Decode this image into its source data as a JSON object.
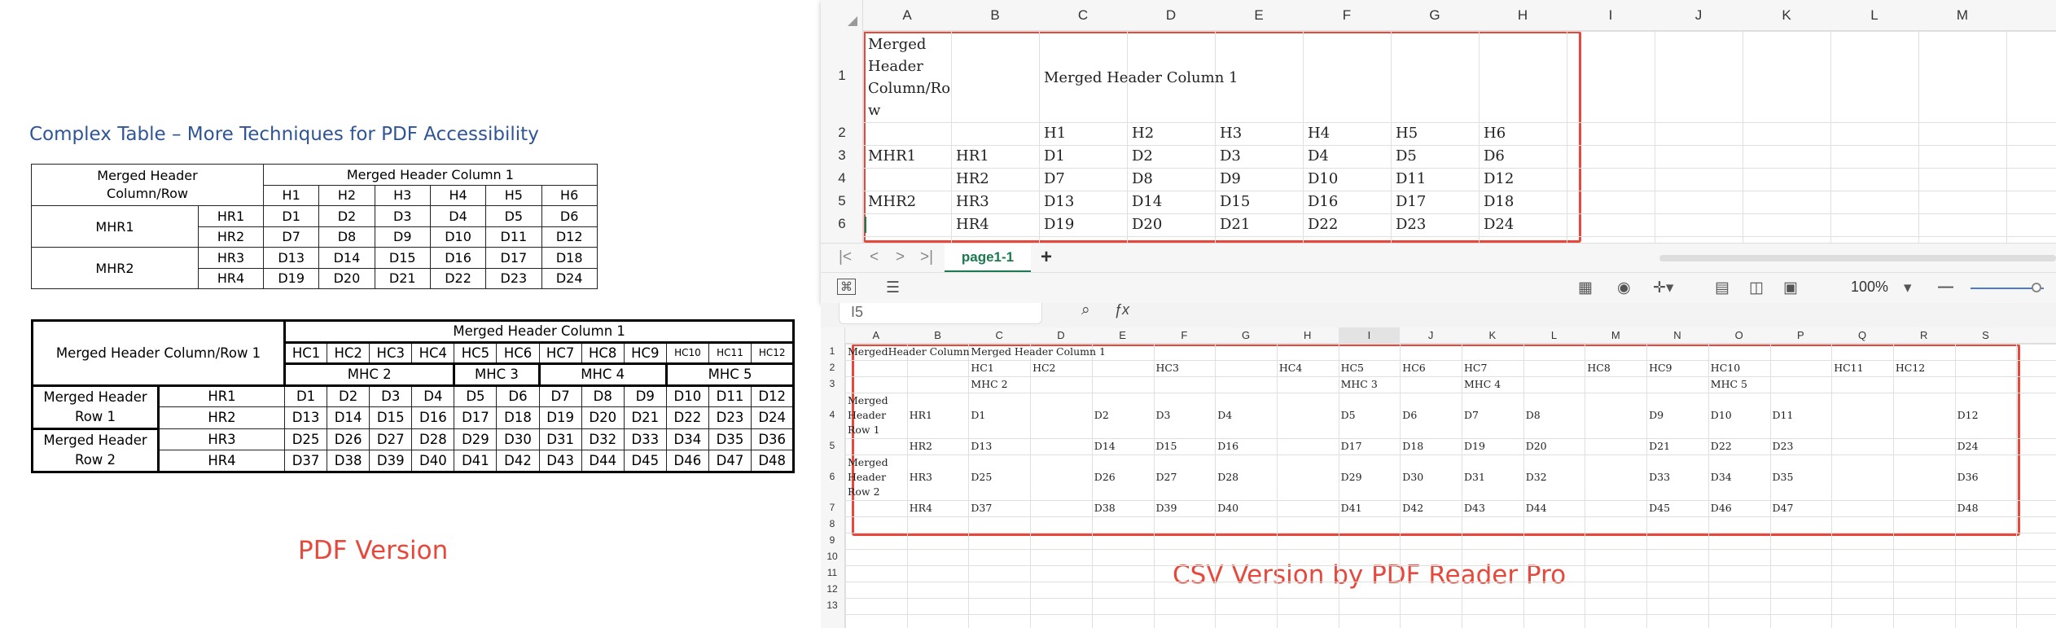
{
  "pdf_panel": {
    "title": "Complex Table – More Techniques for PDF Accessibility",
    "caption": "PDF Version",
    "table1": {
      "corner": "Merged Header\nColumn/Row",
      "merged_col": "Merged Header Column 1",
      "headers": [
        "H1",
        "H2",
        "H3",
        "H4",
        "H5",
        "H6"
      ],
      "groups": [
        {
          "label": "MHR1",
          "rows": [
            {
              "h": "HR1",
              "cells": [
                "D1",
                "D2",
                "D3",
                "D4",
                "D5",
                "D6"
              ]
            },
            {
              "h": "HR2",
              "cells": [
                "D7",
                "D8",
                "D9",
                "D10",
                "D11",
                "D12"
              ]
            }
          ]
        },
        {
          "label": "MHR2",
          "rows": [
            {
              "h": "HR3",
              "cells": [
                "D13",
                "D14",
                "D15",
                "D16",
                "D17",
                "D18"
              ]
            },
            {
              "h": "HR4",
              "cells": [
                "D19",
                "D20",
                "D21",
                "D22",
                "D23",
                "D24"
              ]
            }
          ]
        }
      ]
    },
    "table2": {
      "corner": "Merged Header Column/Row 1",
      "merged_col": "Merged Header Column 1",
      "headers": [
        "HC1",
        "HC2",
        "HC3",
        "HC4",
        "HC5",
        "HC6",
        "HC7",
        "HC8",
        "HC9",
        "HC10",
        "HC11",
        "HC12"
      ],
      "sub_headers": [
        {
          "label": "MHC 2",
          "span": 4
        },
        {
          "label": "MHC 3",
          "span": 2
        },
        {
          "label": "MHC 4",
          "span": 3
        },
        {
          "label": "MHC 5",
          "span": 3
        }
      ],
      "groups": [
        {
          "label": "Merged Header\nRow 1",
          "rows": [
            {
              "h": "HR1",
              "cells": [
                "D1",
                "D2",
                "D3",
                "D4",
                "D5",
                "D6",
                "D7",
                "D8",
                "D9",
                "D10",
                "D11",
                "D12"
              ]
            },
            {
              "h": "HR2",
              "cells": [
                "D13",
                "D14",
                "D15",
                "D16",
                "D17",
                "D18",
                "D19",
                "D20",
                "D21",
                "D22",
                "D23",
                "D24"
              ]
            }
          ]
        },
        {
          "label": "Merged Header\nRow 2",
          "rows": [
            {
              "h": "HR3",
              "cells": [
                "D25",
                "D26",
                "D27",
                "D28",
                "D29",
                "D30",
                "D31",
                "D32",
                "D33",
                "D34",
                "D35",
                "D36"
              ]
            },
            {
              "h": "HR4",
              "cells": [
                "D37",
                "D38",
                "D39",
                "D40",
                "D41",
                "D42",
                "D43",
                "D44",
                "D45",
                "D46",
                "D47",
                "D48"
              ]
            }
          ]
        }
      ]
    }
  },
  "sheet1": {
    "col_letters": [
      "A",
      "B",
      "C",
      "D",
      "E",
      "F",
      "G",
      "H",
      "I",
      "J",
      "K",
      "L",
      "M"
    ],
    "row_numbers": [
      "1",
      "2",
      "3",
      "4",
      "5",
      "6"
    ],
    "cells": [
      {
        "col": 0,
        "row": 0,
        "text": "Merged"
      },
      {
        "col": 0,
        "row": 0,
        "text": "Header",
        "line": 1
      },
      {
        "col": 0,
        "row": 0,
        "text": "Column/Ro",
        "line": 2
      },
      {
        "col": 0,
        "row": 0,
        "text": "w",
        "line": 3
      },
      {
        "col": 2,
        "row": 0,
        "text": "Merged Header Column 1",
        "line": 1.5
      },
      {
        "col": 2,
        "row": 1,
        "text": "H1"
      },
      {
        "col": 3,
        "row": 1,
        "text": "H2"
      },
      {
        "col": 4,
        "row": 1,
        "text": "H3"
      },
      {
        "col": 5,
        "row": 1,
        "text": "H4"
      },
      {
        "col": 6,
        "row": 1,
        "text": "H5"
      },
      {
        "col": 7,
        "row": 1,
        "text": "H6"
      },
      {
        "col": 0,
        "row": 2,
        "text": "MHR1"
      },
      {
        "col": 1,
        "row": 2,
        "text": "HR1"
      },
      {
        "col": 2,
        "row": 2,
        "text": "D1"
      },
      {
        "col": 3,
        "row": 2,
        "text": "D2"
      },
      {
        "col": 4,
        "row": 2,
        "text": "D3"
      },
      {
        "col": 5,
        "row": 2,
        "text": "D4"
      },
      {
        "col": 6,
        "row": 2,
        "text": "D5"
      },
      {
        "col": 7,
        "row": 2,
        "text": "D6"
      },
      {
        "col": 1,
        "row": 3,
        "text": "HR2"
      },
      {
        "col": 2,
        "row": 3,
        "text": "D7"
      },
      {
        "col": 3,
        "row": 3,
        "text": "D8"
      },
      {
        "col": 4,
        "row": 3,
        "text": "D9"
      },
      {
        "col": 5,
        "row": 3,
        "text": "D10"
      },
      {
        "col": 6,
        "row": 3,
        "text": "D11"
      },
      {
        "col": 7,
        "row": 3,
        "text": "D12"
      },
      {
        "col": 0,
        "row": 4,
        "text": "MHR2"
      },
      {
        "col": 1,
        "row": 4,
        "text": "HR3"
      },
      {
        "col": 2,
        "row": 4,
        "text": "D13"
      },
      {
        "col": 3,
        "row": 4,
        "text": "D14"
      },
      {
        "col": 4,
        "row": 4,
        "text": "D15"
      },
      {
        "col": 5,
        "row": 4,
        "text": "D16"
      },
      {
        "col": 6,
        "row": 4,
        "text": "D17"
      },
      {
        "col": 7,
        "row": 4,
        "text": "D18"
      },
      {
        "col": 1,
        "row": 5,
        "text": "HR4"
      },
      {
        "col": 2,
        "row": 5,
        "text": "D19"
      },
      {
        "col": 3,
        "row": 5,
        "text": "D20"
      },
      {
        "col": 4,
        "row": 5,
        "text": "D21"
      },
      {
        "col": 5,
        "row": 5,
        "text": "D22"
      },
      {
        "col": 6,
        "row": 5,
        "text": "D23"
      },
      {
        "col": 7,
        "row": 5,
        "text": "D24"
      }
    ],
    "sheet_tab": "page1-1",
    "zoom": "100%"
  },
  "sheet2": {
    "name_box": "I5",
    "col_letters": [
      "A",
      "B",
      "C",
      "D",
      "E",
      "F",
      "G",
      "H",
      "I",
      "J",
      "K",
      "L",
      "M",
      "N",
      "O",
      "P",
      "Q",
      "R",
      "S"
    ],
    "row_numbers": [
      "1",
      "2",
      "3",
      "4",
      "5",
      "6",
      "7",
      "8",
      "9",
      "10",
      "11",
      "12",
      "13"
    ],
    "caption": "CSV Version by PDF Reader Pro",
    "cells": [
      {
        "col": 0,
        "row": 0,
        "text": "MergedHeader Column"
      },
      {
        "col": 2,
        "row": 0,
        "text": "Merged Header Column 1"
      },
      {
        "col": 2,
        "row": 1,
        "text": "HC1"
      },
      {
        "col": 3,
        "row": 1,
        "text": "HC2"
      },
      {
        "col": 5,
        "row": 1,
        "text": "HC3"
      },
      {
        "col": 7,
        "row": 1,
        "text": "HC4"
      },
      {
        "col": 8,
        "row": 1,
        "text": "HC5"
      },
      {
        "col": 9,
        "row": 1,
        "text": "HC6"
      },
      {
        "col": 10,
        "row": 1,
        "text": "HC7"
      },
      {
        "col": 12,
        "row": 1,
        "text": "HC8"
      },
      {
        "col": 13,
        "row": 1,
        "text": "HC9"
      },
      {
        "col": 14,
        "row": 1,
        "text": "HC10"
      },
      {
        "col": 16,
        "row": 1,
        "text": "HC11"
      },
      {
        "col": 17,
        "row": 1,
        "text": "HC12"
      },
      {
        "col": 2,
        "row": 2,
        "text": "MHC 2"
      },
      {
        "col": 8,
        "row": 2,
        "text": "MHC 3"
      },
      {
        "col": 10,
        "row": 2,
        "text": "MHC 4"
      },
      {
        "col": 14,
        "row": 2,
        "text": "MHC 5"
      },
      {
        "col": 0,
        "row": 3,
        "text": "Merged"
      },
      {
        "col": 0,
        "row": 3,
        "text": "Header",
        "line": 1
      },
      {
        "col": 0,
        "row": 3,
        "text": "Row 1",
        "line": 2
      },
      {
        "col": 1,
        "row": 3,
        "text": "HR1",
        "line": 1
      },
      {
        "col": 2,
        "row": 3,
        "text": "D1",
        "line": 1
      },
      {
        "col": 4,
        "row": 3,
        "text": "D2",
        "line": 1
      },
      {
        "col": 5,
        "row": 3,
        "text": "D3",
        "line": 1
      },
      {
        "col": 6,
        "row": 3,
        "text": "D4",
        "line": 1
      },
      {
        "col": 8,
        "row": 3,
        "text": "D5",
        "line": 1
      },
      {
        "col": 9,
        "row": 3,
        "text": "D6",
        "line": 1
      },
      {
        "col": 10,
        "row": 3,
        "text": "D7",
        "line": 1
      },
      {
        "col": 11,
        "row": 3,
        "text": "D8",
        "line": 1
      },
      {
        "col": 13,
        "row": 3,
        "text": "D9",
        "line": 1
      },
      {
        "col": 14,
        "row": 3,
        "text": "D10",
        "line": 1
      },
      {
        "col": 15,
        "row": 3,
        "text": "D11",
        "line": 1
      },
      {
        "col": 18,
        "row": 3,
        "text": "D12",
        "line": 1
      },
      {
        "col": 1,
        "row": 4,
        "text": "HR2"
      },
      {
        "col": 2,
        "row": 4,
        "text": "D13"
      },
      {
        "col": 4,
        "row": 4,
        "text": "D14"
      },
      {
        "col": 5,
        "row": 4,
        "text": "D15"
      },
      {
        "col": 6,
        "row": 4,
        "text": "D16"
      },
      {
        "col": 8,
        "row": 4,
        "text": "D17"
      },
      {
        "col": 9,
        "row": 4,
        "text": "D18"
      },
      {
        "col": 10,
        "row": 4,
        "text": "D19"
      },
      {
        "col": 11,
        "row": 4,
        "text": "D20"
      },
      {
        "col": 13,
        "row": 4,
        "text": "D21"
      },
      {
        "col": 14,
        "row": 4,
        "text": "D22"
      },
      {
        "col": 15,
        "row": 4,
        "text": "D23"
      },
      {
        "col": 18,
        "row": 4,
        "text": "D24"
      },
      {
        "col": 0,
        "row": 5,
        "text": "Merged"
      },
      {
        "col": 0,
        "row": 5,
        "text": "Header",
        "line": 1
      },
      {
        "col": 0,
        "row": 5,
        "text": "Row 2",
        "line": 2
      },
      {
        "col": 1,
        "row": 5,
        "text": "HR3",
        "line": 1
      },
      {
        "col": 2,
        "row": 5,
        "text": "D25",
        "line": 1
      },
      {
        "col": 4,
        "row": 5,
        "text": "D26",
        "line": 1
      },
      {
        "col": 5,
        "row": 5,
        "text": "D27",
        "line": 1
      },
      {
        "col": 6,
        "row": 5,
        "text": "D28",
        "line": 1
      },
      {
        "col": 8,
        "row": 5,
        "text": "D29",
        "line": 1
      },
      {
        "col": 9,
        "row": 5,
        "text": "D30",
        "line": 1
      },
      {
        "col": 10,
        "row": 5,
        "text": "D31",
        "line": 1
      },
      {
        "col": 11,
        "row": 5,
        "text": "D32",
        "line": 1
      },
      {
        "col": 13,
        "row": 5,
        "text": "D33",
        "line": 1
      },
      {
        "col": 14,
        "row": 5,
        "text": "D34",
        "line": 1
      },
      {
        "col": 15,
        "row": 5,
        "text": "D35",
        "line": 1
      },
      {
        "col": 18,
        "row": 5,
        "text": "D36",
        "line": 1
      },
      {
        "col": 1,
        "row": 6,
        "text": "HR4"
      },
      {
        "col": 2,
        "row": 6,
        "text": "D37"
      },
      {
        "col": 4,
        "row": 6,
        "text": "D38"
      },
      {
        "col": 5,
        "row": 6,
        "text": "D39"
      },
      {
        "col": 6,
        "row": 6,
        "text": "D40"
      },
      {
        "col": 8,
        "row": 6,
        "text": "D41"
      },
      {
        "col": 9,
        "row": 6,
        "text": "D42"
      },
      {
        "col": 10,
        "row": 6,
        "text": "D43"
      },
      {
        "col": 11,
        "row": 6,
        "text": "D44"
      },
      {
        "col": 13,
        "row": 6,
        "text": "D45"
      },
      {
        "col": 14,
        "row": 6,
        "text": "D46"
      },
      {
        "col": 15,
        "row": 6,
        "text": "D47"
      },
      {
        "col": 18,
        "row": 6,
        "text": "D48"
      }
    ]
  },
  "icons": [
    "first-sheet-icon",
    "prev-sheet-icon",
    "next-sheet-icon",
    "last-sheet-icon",
    "add-sheet-icon",
    "search-icon",
    "fx-icon",
    "view-normal-icon",
    "view-page-icon",
    "zoom-out-icon"
  ],
  "colors": {
    "accent_red": "#e8473b",
    "title_blue": "#2f5597",
    "sheet_green": "#1b7a4e"
  }
}
